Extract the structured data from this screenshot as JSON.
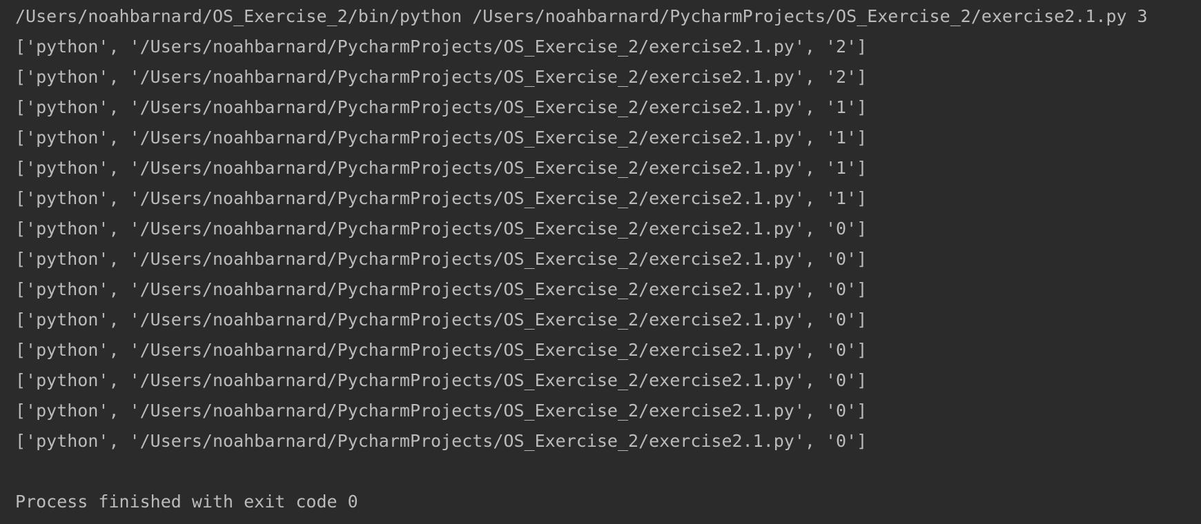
{
  "console": {
    "command": "/Users/noahbarnard/OS_Exercise_2/bin/python /Users/noahbarnard/PycharmProjects/OS_Exercise_2/exercise2.1.py 3",
    "output_lines": [
      "['python', '/Users/noahbarnard/PycharmProjects/OS_Exercise_2/exercise2.1.py', '2']",
      "['python', '/Users/noahbarnard/PycharmProjects/OS_Exercise_2/exercise2.1.py', '2']",
      "['python', '/Users/noahbarnard/PycharmProjects/OS_Exercise_2/exercise2.1.py', '1']",
      "['python', '/Users/noahbarnard/PycharmProjects/OS_Exercise_2/exercise2.1.py', '1']",
      "['python', '/Users/noahbarnard/PycharmProjects/OS_Exercise_2/exercise2.1.py', '1']",
      "['python', '/Users/noahbarnard/PycharmProjects/OS_Exercise_2/exercise2.1.py', '1']",
      "['python', '/Users/noahbarnard/PycharmProjects/OS_Exercise_2/exercise2.1.py', '0']",
      "['python', '/Users/noahbarnard/PycharmProjects/OS_Exercise_2/exercise2.1.py', '0']",
      "['python', '/Users/noahbarnard/PycharmProjects/OS_Exercise_2/exercise2.1.py', '0']",
      "['python', '/Users/noahbarnard/PycharmProjects/OS_Exercise_2/exercise2.1.py', '0']",
      "['python', '/Users/noahbarnard/PycharmProjects/OS_Exercise_2/exercise2.1.py', '0']",
      "['python', '/Users/noahbarnard/PycharmProjects/OS_Exercise_2/exercise2.1.py', '0']",
      "['python', '/Users/noahbarnard/PycharmProjects/OS_Exercise_2/exercise2.1.py', '0']",
      "['python', '/Users/noahbarnard/PycharmProjects/OS_Exercise_2/exercise2.1.py', '0']"
    ],
    "exit_message": "Process finished with exit code 0"
  },
  "colors": {
    "background": "#2b2b2b",
    "text": "#bbbbbb"
  }
}
